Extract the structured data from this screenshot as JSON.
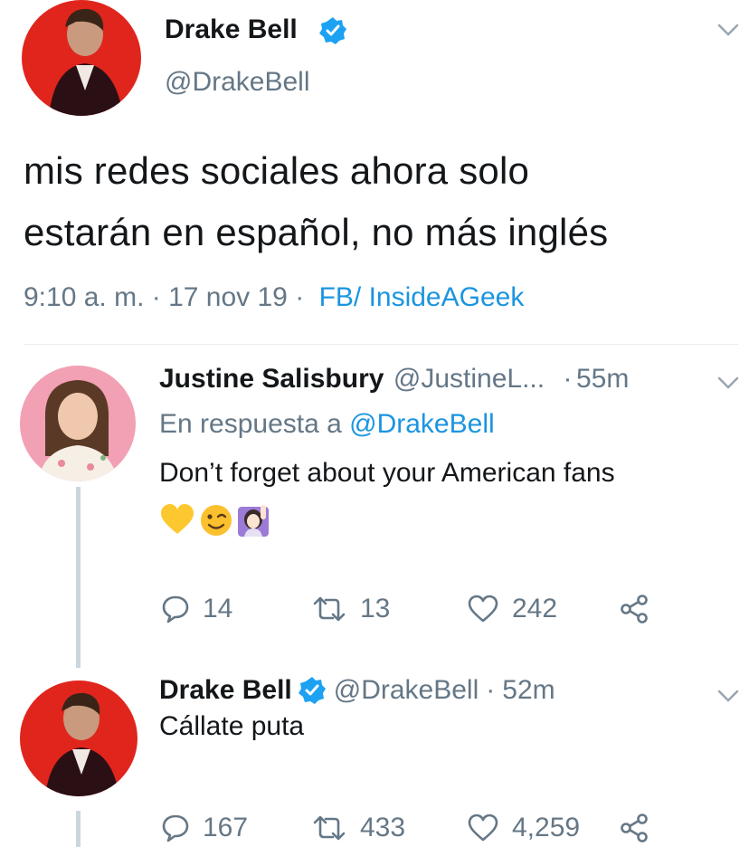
{
  "main_tweet": {
    "author_name": "Drake Bell",
    "author_handle": "@DrakeBell",
    "text_line1": "mis redes sociales ahora solo",
    "text_line2": "estarán en español, no más inglés",
    "time": "9:10 a. m.",
    "date": "17 nov 19",
    "source": "FB/ InsideAGeek",
    "sep": "·"
  },
  "reply1": {
    "author_name": "Justine Salisbury",
    "author_handle": "@JustineL...",
    "age": "55m",
    "sep": "·",
    "reply_prefix": "En respuesta a",
    "reply_to": "@DrakeBell",
    "text": "Don’t forget about your American fans",
    "emojis": [
      "yellow-heart",
      "winking-face",
      "woman-raising-hand"
    ],
    "replies": "14",
    "retweets": "13",
    "likes": "242"
  },
  "reply2": {
    "author_name": "Drake Bell",
    "author_handle": "@DrakeBell",
    "age": "52m",
    "sep": "·",
    "text": "Cállate puta",
    "replies": "167",
    "retweets": "433",
    "likes": "4,259"
  },
  "colors": {
    "text": "#14171a",
    "muted": "#657786",
    "link": "#1b95e0",
    "verified": "#1da1f2",
    "avatar_bg": "#e0251d"
  }
}
